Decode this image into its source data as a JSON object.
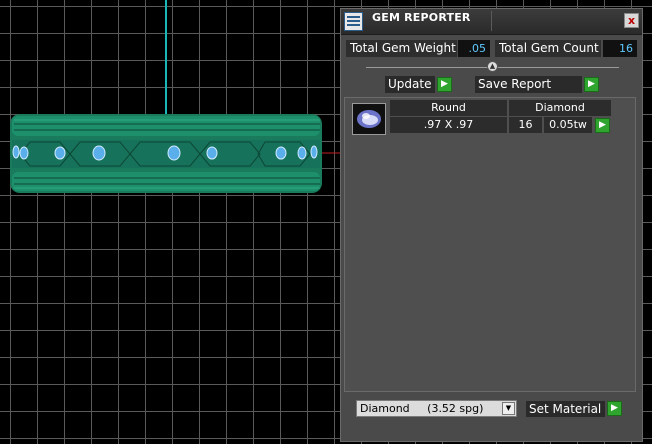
{
  "panel": {
    "title": "GEM REPORTER",
    "close_label": "x",
    "total_weight_label": "Total Gem Weight",
    "total_weight_value": ".05",
    "total_count_label": "Total Gem Count",
    "total_count_value": "16",
    "update_label": "Update",
    "save_report_label": "Save Report",
    "go_glyph": "▶",
    "slider_glyph": "▲"
  },
  "gem_row": {
    "shape": "Round",
    "material": "Diamond",
    "size": ".97 X .97",
    "count": "16",
    "weight": "0.05tw"
  },
  "footer": {
    "material_select_value": "Diamond     (3.52 spg)",
    "dropdown_glyph": "▼",
    "set_material_label": "Set Material"
  },
  "colors": {
    "accent_green": "#2fa42f",
    "value_text": "#5fc9ff",
    "ring_green": "#1f8a68",
    "gem_blue": "#5aaeea"
  },
  "icons": [
    "app-icon",
    "close-icon",
    "slider-knob-icon",
    "play-icon",
    "diamond-gem-icon",
    "chevron-down-icon"
  ]
}
